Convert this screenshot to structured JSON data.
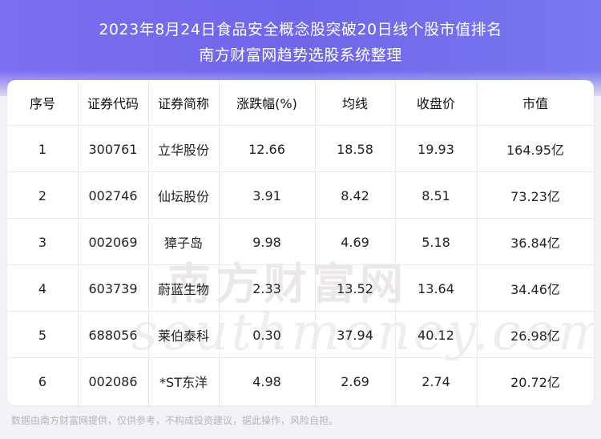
{
  "title_line1": "2023年8月24日食品安全概念股突破20日线个股市值排名",
  "title_line2": "南方财富网趋势选股系统整理",
  "colors": {
    "hero": "#7c6ff0",
    "background": "#f3f3f7"
  },
  "table": {
    "headers": [
      "序号",
      "证券代码",
      "证券简称",
      "涨跌幅(%)",
      "均线",
      "收盘价",
      "市值"
    ],
    "rows": [
      [
        "1",
        "300761",
        "立华股份",
        "12.66",
        "18.58",
        "19.93",
        "164.95亿"
      ],
      [
        "2",
        "002746",
        "仙坛股份",
        "3.91",
        "8.42",
        "8.51",
        "73.23亿"
      ],
      [
        "3",
        "002069",
        "獐子岛",
        "9.98",
        "4.69",
        "5.18",
        "36.84亿"
      ],
      [
        "4",
        "603739",
        "蔚蓝生物",
        "2.33",
        "13.52",
        "13.64",
        "34.46亿"
      ],
      [
        "5",
        "688056",
        "莱伯泰科",
        "0.30",
        "37.94",
        "40.12",
        "26.98亿"
      ],
      [
        "6",
        "002086",
        "*ST东洋",
        "4.98",
        "2.69",
        "2.74",
        "20.72亿"
      ]
    ]
  },
  "watermark": {
    "cn": "南方财富网",
    "en": "southmoney.com"
  },
  "footer": "数据由南方财富网提供，仅供参考，不构成投资建议，据此操作，风险自担。"
}
